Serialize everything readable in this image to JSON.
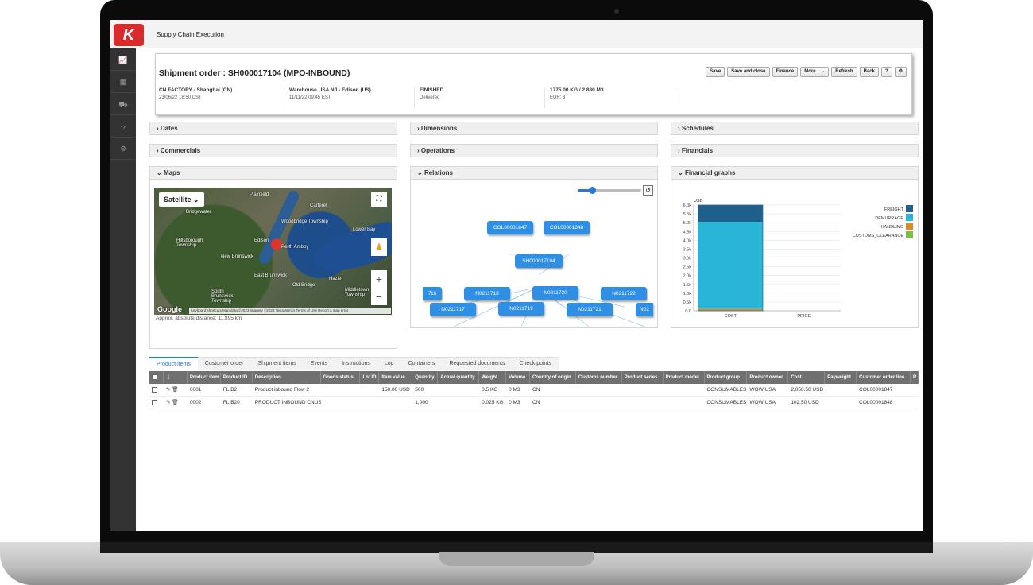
{
  "app": {
    "title": "Supply Chain Execution",
    "logo": "K"
  },
  "sidebar": {
    "items": [
      {
        "icon": "chart-icon",
        "glyph": "📈"
      },
      {
        "icon": "calendar-icon",
        "glyph": "▦"
      },
      {
        "icon": "truck-icon",
        "glyph": "⛟"
      },
      {
        "icon": "code-icon",
        "glyph": "‹›"
      },
      {
        "icon": "gear-icon",
        "glyph": "⚙"
      }
    ]
  },
  "shipment": {
    "title": "Shipment order : SH000017104 (MPO-INBOUND)",
    "buttons": {
      "save": "Save",
      "save_close": "Save and close",
      "finance": "Finance",
      "more": "More...",
      "refresh": "Refresh",
      "back": "Back",
      "help": "?",
      "settings": "⚙"
    },
    "origin": {
      "name": "CN FACTORY - Shanghai (CN)",
      "date": "23/06/22 18:50 CST"
    },
    "destination": {
      "name": "Warehouse USA NJ - Edison (US)",
      "date": "11/11/22 09:45 EST"
    },
    "status": {
      "name": "FINISHED",
      "sub": "Delivered"
    },
    "measures": {
      "weight_volume": "1775.00 KG / 2.880 M3",
      "amount": "EUR: 3"
    }
  },
  "panels": {
    "dates": "Dates",
    "dimensions": "Dimensions",
    "schedules": "Schedules",
    "commercials": "Commercials",
    "operations": "Operations",
    "financials": "Financials",
    "maps": "Maps",
    "relations": "Relations",
    "financial_graphs": "Financial graphs"
  },
  "map": {
    "type_button": "Satellite",
    "labels": [
      "Plainfield",
      "Bridgewater",
      "Hillsborough Township",
      "Woodbridge Township",
      "Edison",
      "Perth Amboy",
      "New Brunswick",
      "East Brunswick",
      "Old Bridge",
      "Hazlet",
      "Middletown Township",
      "South Brunswick Township",
      "Carteret",
      "Lower Bay"
    ],
    "google": "Google",
    "attribution": "Keyboard shortcuts   Map data ©2023 Imagery ©2023 TerraMetrics   Terms of Use   Report a map error",
    "distance": "Approx. absolute distance: 11,895 km"
  },
  "relations": {
    "nodes": [
      {
        "label": "COL00001847"
      },
      {
        "label": "COL00001848"
      },
      {
        "label": "SH000017104"
      },
      {
        "label": "716"
      },
      {
        "label": "N0211718"
      },
      {
        "label": "N0211720"
      },
      {
        "label": "N0211722"
      },
      {
        "label": "N0211717"
      },
      {
        "label": "N0211719"
      },
      {
        "label": "N0211721"
      },
      {
        "label": "N02"
      }
    ],
    "reset_icon": "↺"
  },
  "chart_data": {
    "type": "bar",
    "ylabel": "USD",
    "categories": [
      "COST",
      "PRICE"
    ],
    "ylim": [
      0,
      6000
    ],
    "yticks": [
      "0.0",
      "0.5k",
      "1.0k",
      "1.5k",
      "2.0k",
      "2.5k",
      "3.0k",
      "3.5k",
      "4.0k",
      "4.5k",
      "5.0k",
      "5.5k",
      "6.0k"
    ],
    "stacked": true,
    "series": [
      {
        "name": "FREIGHT",
        "color": "#1f5f8b",
        "values": [
          950,
          0
        ]
      },
      {
        "name": "DEMURRAGE",
        "color": "#29b6d6",
        "values": [
          4950,
          0
        ]
      },
      {
        "name": "HANDLING",
        "color": "#e08a2a",
        "values": [
          100,
          0
        ]
      },
      {
        "name": "CUSTOMS_CLEARANCE",
        "color": "#7fbf3f",
        "values": [
          0,
          0
        ]
      }
    ],
    "legend": "top-right",
    "grid": true
  },
  "tabs": [
    "Product items",
    "Customer order",
    "Shipment items",
    "Events",
    "Instructions",
    "Log",
    "Containers",
    "Requested documents",
    "Check points"
  ],
  "table": {
    "headers": [
      "Product item",
      "Product ID",
      "Description",
      "Goods status",
      "Lot ID",
      "Item value",
      "Quantity",
      "Actual quantity",
      "Weight",
      "Volume",
      "Country of origin",
      "Customs number",
      "Product series",
      "Product model",
      "Product group",
      "Product owner",
      "Cost",
      "Payweight",
      "Customer order line",
      "R"
    ],
    "rows": [
      [
        "0001",
        "FLIB2",
        "Product inbound Flow 2",
        "",
        "",
        "150.00 USD",
        "500",
        "",
        "0.5 KG",
        "0 M3",
        "CN",
        "",
        "",
        "",
        "CONSUMABLES",
        "WOW USA",
        "2,050.50 USD",
        "",
        "COL00001847",
        ""
      ],
      [
        "0002",
        "FLIB20",
        "PRODUCT INBOUND CNUS",
        "",
        "",
        "",
        "1,000",
        "",
        "0.025 KG",
        "0 M3",
        "CN",
        "",
        "",
        "",
        "CONSUMABLES",
        "WOW USA",
        "102.50 USD",
        "",
        "COL00001848",
        ""
      ]
    ]
  }
}
